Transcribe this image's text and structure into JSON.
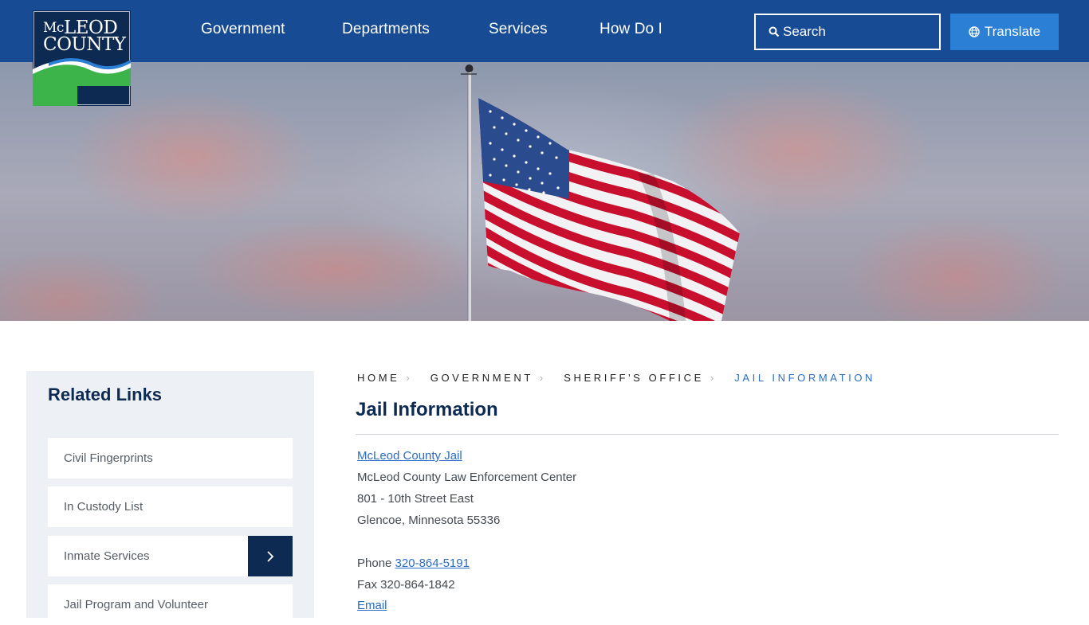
{
  "logo": {
    "line1_prefix": "Mc",
    "line1": "LEOD",
    "line2": "COUNTY"
  },
  "nav": {
    "items": [
      {
        "label": "Government"
      },
      {
        "label": "Departments"
      },
      {
        "label": "Services"
      },
      {
        "label": "How Do I"
      }
    ],
    "search_label": "Search",
    "translate_label": "Translate"
  },
  "sidebar": {
    "title": "Related Links",
    "items": [
      {
        "label": "Civil Fingerprints"
      },
      {
        "label": "In Custody List"
      },
      {
        "label": "Inmate Services"
      },
      {
        "label": "Jail Program and Volunteer"
      }
    ]
  },
  "breadcrumb": {
    "items": [
      "HOME",
      "GOVERNMENT",
      "SHERIFF'S OFFICE"
    ],
    "current": "JAIL INFORMATION"
  },
  "page": {
    "title": "Jail Information",
    "jail_link": "McLeod County Jail",
    "address_line1": "McLeod County Law Enforcement Center",
    "address_line2": "801 - 10th Street East",
    "address_line3": "Glencoe, Minnesota 55336",
    "phone_label": "Phone",
    "phone": "320-864-5191",
    "fax": "Fax 320-864-1842",
    "email_link": "Email"
  },
  "colors": {
    "header": "#174b94",
    "accent": "#2b7fd4",
    "navy": "#0d2a52",
    "link": "#2b6cc4"
  }
}
